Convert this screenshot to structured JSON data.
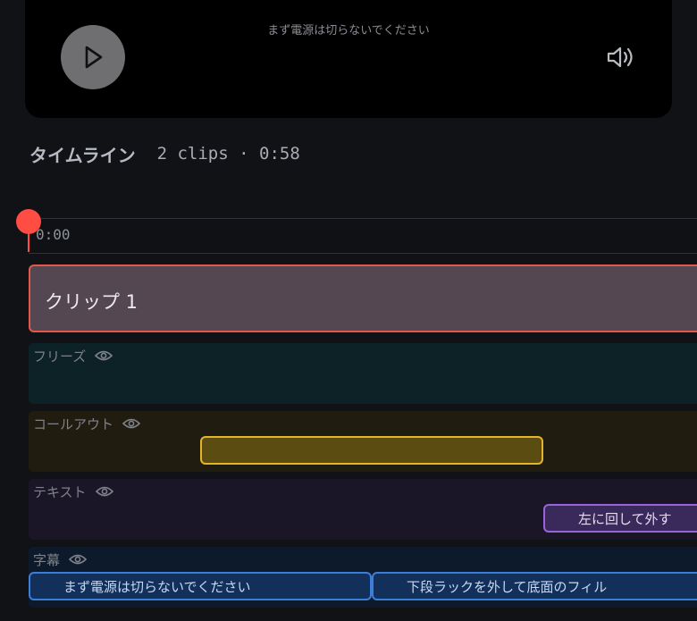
{
  "player": {
    "caption": "まず電源は切らないでください",
    "play_icon": "play-icon",
    "volume_icon": "volume-icon"
  },
  "timeline": {
    "title": "タイムライン",
    "meta": "2 clips · 0:58",
    "ruler_time": "0:00",
    "clip": {
      "label": "クリップ 1"
    },
    "tracks": [
      {
        "name": "フリーズ",
        "icon": "eye-icon"
      },
      {
        "name": "コールアウト",
        "icon": "eye-icon"
      },
      {
        "name": "テキスト",
        "icon": "eye-icon"
      },
      {
        "name": "字幕",
        "icon": "eye-icon"
      }
    ],
    "text_block": "左に回して外す",
    "subtitles": [
      "まず電源は切らないでください",
      "下段ラックを外して底面のフィル"
    ]
  },
  "colors": {
    "playhead": "#ff4d44",
    "clip_border": "#e2584b",
    "callout_border": "#e4b529",
    "text_border": "#9b63d9",
    "subtitle_border": "#3c7fd9"
  }
}
